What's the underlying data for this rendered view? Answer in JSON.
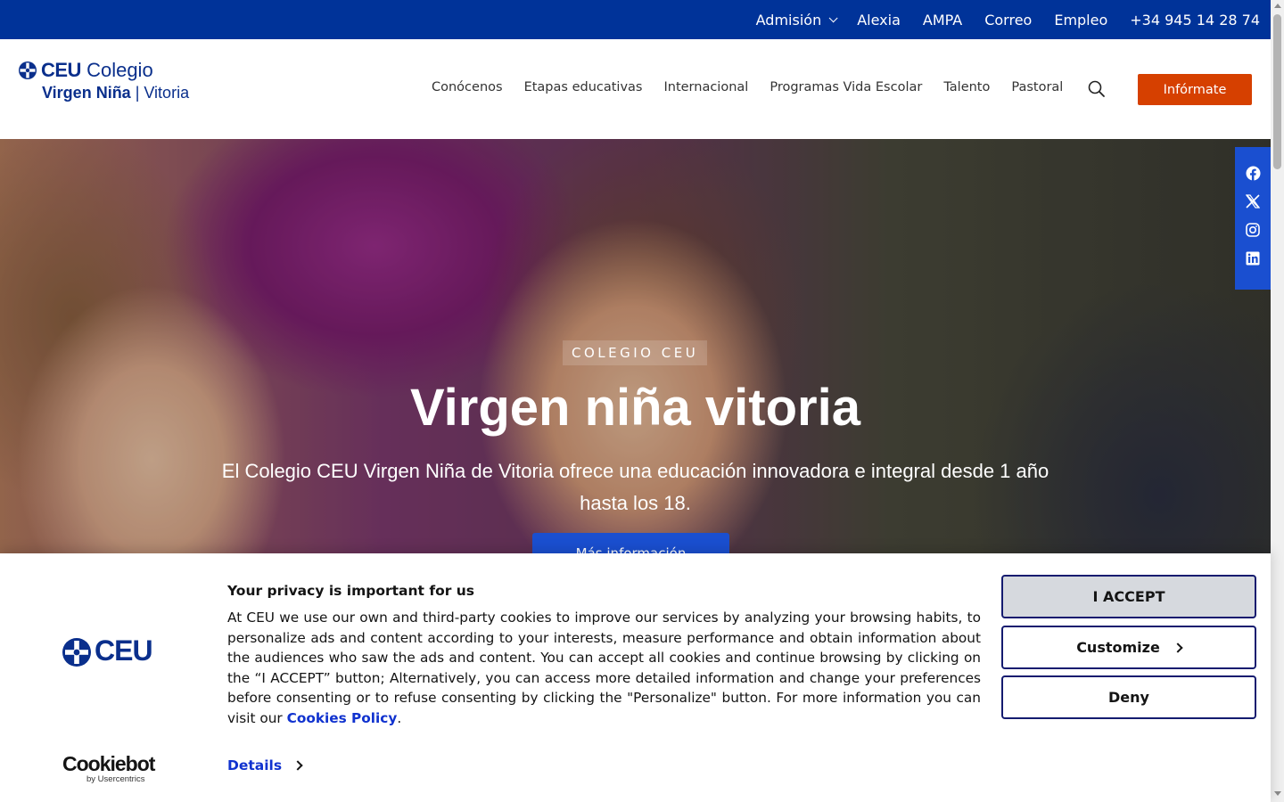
{
  "topbar": {
    "admision": "Admisión",
    "alexia": "Alexia",
    "ampa": "AMPA",
    "correo": "Correo",
    "empleo": "Empleo",
    "phone": "+34 945 14 28 74"
  },
  "logo": {
    "brand": "CEU",
    "line1": "Colegio",
    "line2_bold": "Virgen Niña",
    "line2_rest": " | Vitoria"
  },
  "nav": {
    "items": [
      "Conócenos",
      "Etapas educativas",
      "Internacional",
      "Programas Vida Escolar",
      "Talento",
      "Pastoral"
    ],
    "cta": "Infórmate"
  },
  "hero": {
    "kicker": "COLEGIO CEU",
    "title": "Virgen niña vitoria",
    "description": "El Colegio CEU Virgen Niña de Vitoria ofrece una educación innovadora e integral desde 1 año hasta los 18.",
    "button": "Más información"
  },
  "cookie": {
    "brand": "CEU",
    "title": "Your privacy is important for us",
    "text": "At CEU we use our own and third-party cookies to improve our services by analyzing your browsing habits, to personalize ads and content according to your interests, measure performance and obtain information about the audiences who saw the ads and content. You can accept all cookies and continue browsing by clicking on the “I ACCEPT” button; Alternatively, you can access more detailed information and change your preferences before consenting or to refuse consenting by clicking the \"Personalize\" button. For more information you can visit our ",
    "policy_link": "Cookies Policy",
    "text_end": ".",
    "details": "Details",
    "accept": "I ACCEPT",
    "customize": "Customize",
    "deny": "Deny",
    "cookiebot": "Cookiebot",
    "cookiebot_sub": "by Usercentrics"
  },
  "colors": {
    "topbar": "#003399",
    "cta": "#d64000",
    "primary": "#1a4fd0",
    "link": "#1032cf"
  }
}
